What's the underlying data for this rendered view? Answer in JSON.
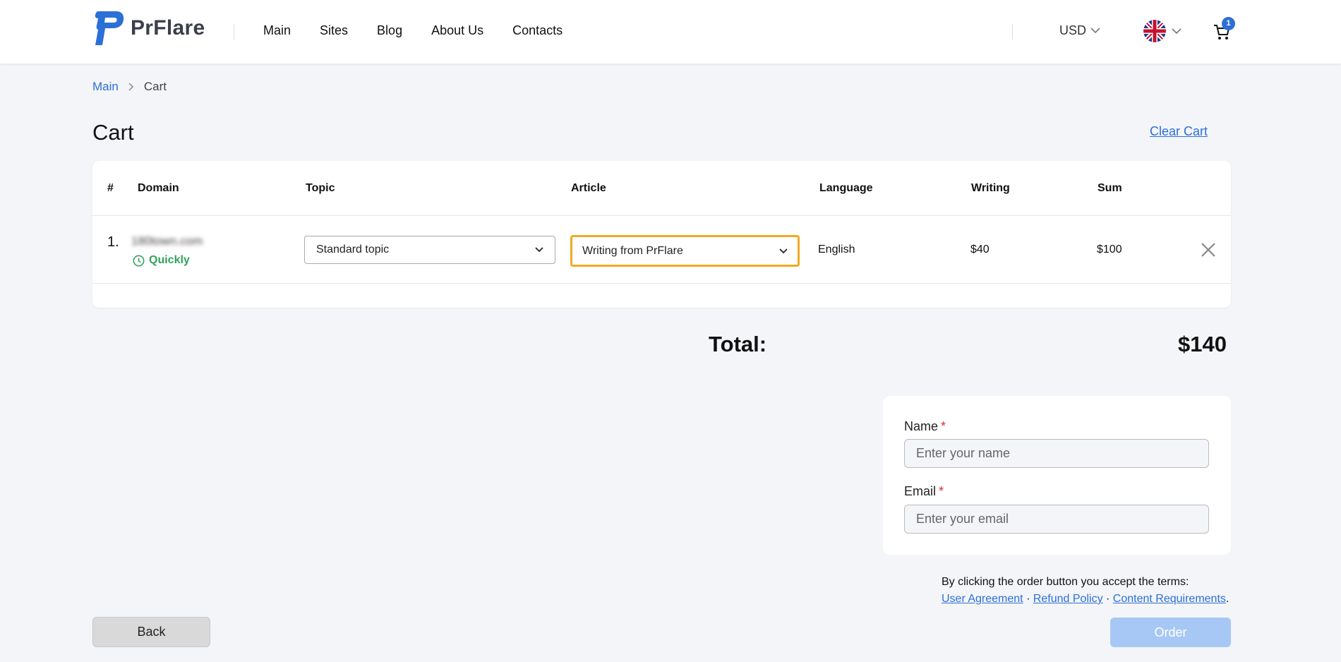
{
  "header": {
    "logo_text": "PrFlare",
    "nav": [
      "Main",
      "Sites",
      "Blog",
      "About Us",
      "Contacts"
    ],
    "currency": "USD",
    "cart_count": "1"
  },
  "breadcrumb": {
    "home": "Main",
    "current": "Cart"
  },
  "page": {
    "title": "Cart",
    "clear_cart": "Clear Cart"
  },
  "table": {
    "headers": {
      "num": "#",
      "domain": "Domain",
      "topic": "Topic",
      "article": "Article",
      "language": "Language",
      "writing": "Writing",
      "sum": "Sum"
    },
    "rows": [
      {
        "num": "1.",
        "domain": "180town.com",
        "speed": "Quickly",
        "topic": "Standard topic",
        "article": "Writing from PrFlare",
        "language": "English",
        "writing": "$40",
        "sum": "$100"
      }
    ]
  },
  "total": {
    "label": "Total:",
    "value": "$140"
  },
  "form": {
    "name_label": "Name",
    "name_placeholder": "Enter your name",
    "email_label": "Email",
    "email_placeholder": "Enter your email",
    "required_mark": "*"
  },
  "terms": {
    "text": "By clicking the order button you accept the terms:",
    "user_agreement": "User Agreement",
    "refund_policy": "Refund Policy",
    "content_requirements": "Content Requirements",
    "separator": "·",
    "end": "."
  },
  "buttons": {
    "back": "Back",
    "order": "Order"
  },
  "colors": {
    "accent": "#2c6fd6",
    "success": "#31a35d",
    "focus": "#f2a922",
    "required": "#e02d2d",
    "order_disabled": "#a7c8f5"
  }
}
